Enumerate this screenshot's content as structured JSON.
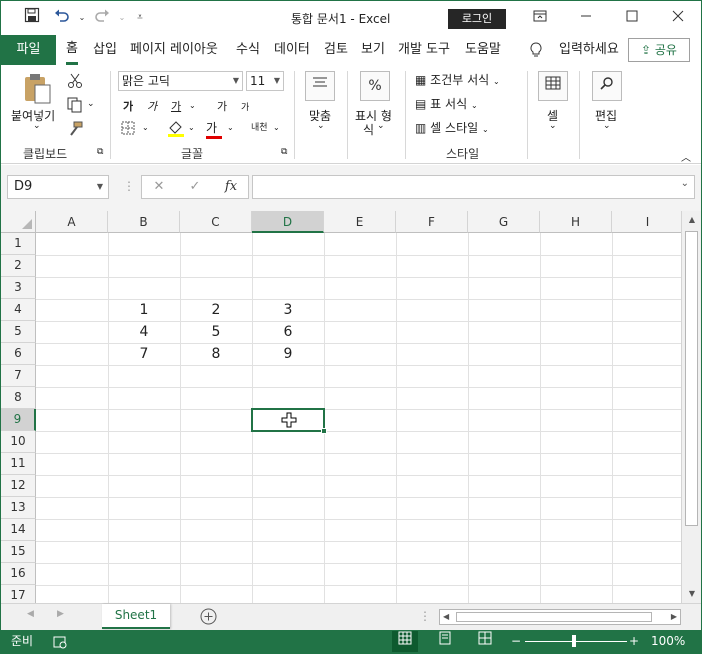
{
  "window": {
    "title": "통합 문서1 - Excel",
    "login_label": "로그인"
  },
  "quick_access": {
    "save_icon": "save-icon",
    "undo_icon": "undo-icon",
    "redo_icon": "redo-icon"
  },
  "tabs": {
    "file": "파일",
    "items": [
      "홈",
      "삽입",
      "페이지 레이아웃",
      "수식",
      "데이터",
      "검토",
      "보기",
      "개발 도구",
      "도움말"
    ],
    "tell_me": "입력하세요",
    "share": "공유"
  },
  "ribbon": {
    "clipboard": {
      "paste": "붙여넣기",
      "label": "클립보드"
    },
    "font": {
      "font_name": "맑은 고딕",
      "font_size": "11",
      "bold": "가",
      "italic": "가",
      "underline": "가",
      "grow": "가",
      "shrink": "가",
      "font_color": "가",
      "phonetic": "내천",
      "label": "글꼴"
    },
    "alignment": {
      "label": "맞춤"
    },
    "number": {
      "label_line1": "표시 형",
      "label_line2": "식",
      "icon_text": "%"
    },
    "styles": {
      "conditional": "조건부 서식",
      "table": "표 서식",
      "cell": "셀 스타일",
      "label": "스타일"
    },
    "cells": {
      "label": "셀"
    },
    "editing": {
      "label": "편집"
    }
  },
  "formula_bar": {
    "name_box": "D9",
    "cancel": "✕",
    "enter": "✓",
    "fx": "fx",
    "content": ""
  },
  "sheet": {
    "columns": [
      "A",
      "B",
      "C",
      "D",
      "E",
      "F",
      "G",
      "H",
      "I"
    ],
    "rows": [
      "1",
      "2",
      "3",
      "4",
      "5",
      "6",
      "7",
      "8",
      "9",
      "10",
      "11",
      "12",
      "13",
      "14",
      "15",
      "16",
      "17"
    ],
    "selected_cell": "D9",
    "cells": [
      {
        "ref": "B4",
        "value": "1"
      },
      {
        "ref": "C4",
        "value": "2"
      },
      {
        "ref": "D4",
        "value": "3"
      },
      {
        "ref": "B5",
        "value": "4"
      },
      {
        "ref": "C5",
        "value": "5"
      },
      {
        "ref": "D5",
        "value": "6"
      },
      {
        "ref": "B6",
        "value": "7"
      },
      {
        "ref": "C6",
        "value": "8"
      },
      {
        "ref": "D6",
        "value": "9"
      }
    ]
  },
  "sheet_tabs": {
    "active": "Sheet1",
    "add_icon": "add-sheet-icon"
  },
  "status": {
    "ready": "준비",
    "zoom": "100%"
  },
  "colors": {
    "accent": "#217346"
  }
}
